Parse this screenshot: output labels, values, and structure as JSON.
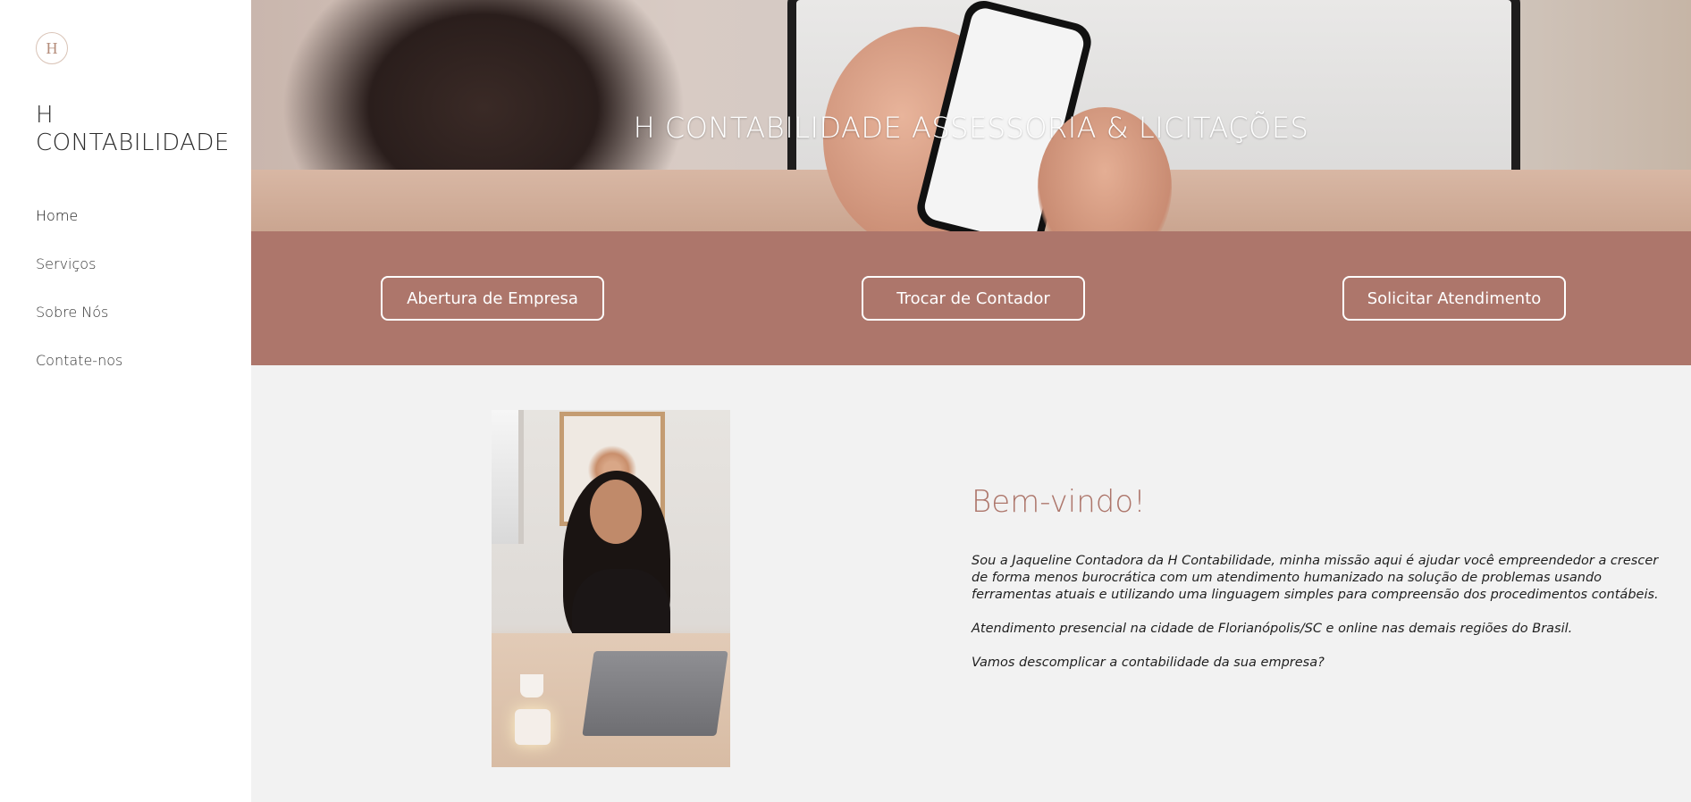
{
  "sidebar": {
    "logo_letter": "H",
    "brand": "H CONTABILIDADE",
    "nav": [
      {
        "label": "Home",
        "active": true
      },
      {
        "label": "Serviços"
      },
      {
        "label": "Sobre Nós"
      },
      {
        "label": "Contate-nos"
      }
    ]
  },
  "hero": {
    "title": "H CONTABILIDADE ASSESSORIA & LICITAÇÕES"
  },
  "actions": {
    "open_company": "Abertura de Empresa",
    "change_accountant": "Trocar de Contador",
    "request_service": "Solicitar Atendimento"
  },
  "about": {
    "heading": "Bem-vindo!",
    "paragraphs": [
      "Sou a Jaqueline Contadora da H Contabilidade, minha missão aqui é ajudar você empreendedor a crescer de forma menos burocrática com um atendimento humanizado na solução de problemas usando ferramentas atuais e utilizando uma linguagem simples para compreensão dos procedimentos contábeis.",
      "Atendimento presencial na cidade de Florianópolis/SC e online nas demais regiões do Brasil.",
      "Vamos descomplicar a contabilidade da sua empresa?"
    ]
  },
  "colors": {
    "accent": "#ad766b",
    "background": "#f2f2f2",
    "sidebar": "#ffffff"
  }
}
